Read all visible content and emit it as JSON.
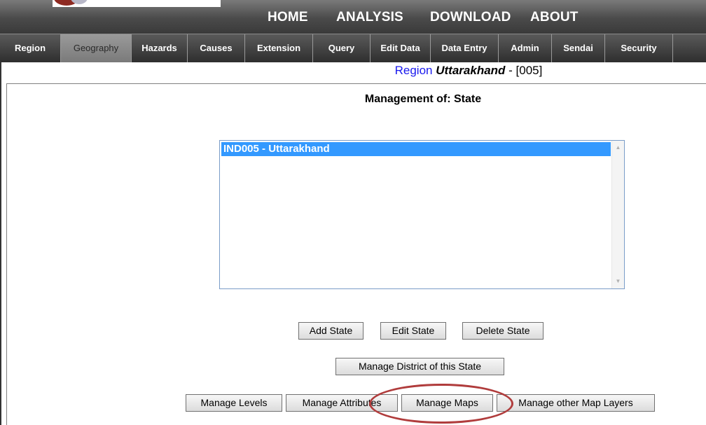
{
  "top_nav": {
    "items": [
      "HOME",
      "ANALYSIS",
      "DOWNLOAD",
      "ABOUT"
    ]
  },
  "tabs": {
    "items": [
      "Region",
      "Geography",
      "Hazards",
      "Causes",
      "Extension",
      "Query",
      "Edit Data",
      "Data Entry",
      "Admin",
      "Sendai",
      "Security"
    ],
    "active": "Geography"
  },
  "region": {
    "label": "Region",
    "name": "Uttarakhand",
    "code": "- [005]"
  },
  "management": {
    "title": "Management of:  State"
  },
  "listbox": {
    "items": [
      "IND005 - Uttarakhand"
    ],
    "selected": "IND005 - Uttarakhand"
  },
  "buttons": {
    "add_state": "Add State",
    "edit_state": "Edit State",
    "delete_state": "Delete State",
    "manage_district": "Manage District of this  State",
    "manage_levels": "Manage Levels",
    "manage_attributes": "Manage Attributes",
    "manage_maps": "Manage Maps",
    "manage_other_layers": "Manage other Map  Layers"
  },
  "colors": {
    "accent_link": "#1a1aee",
    "selection": "#3399ff",
    "highlight_annotation": "#b03c3c"
  }
}
